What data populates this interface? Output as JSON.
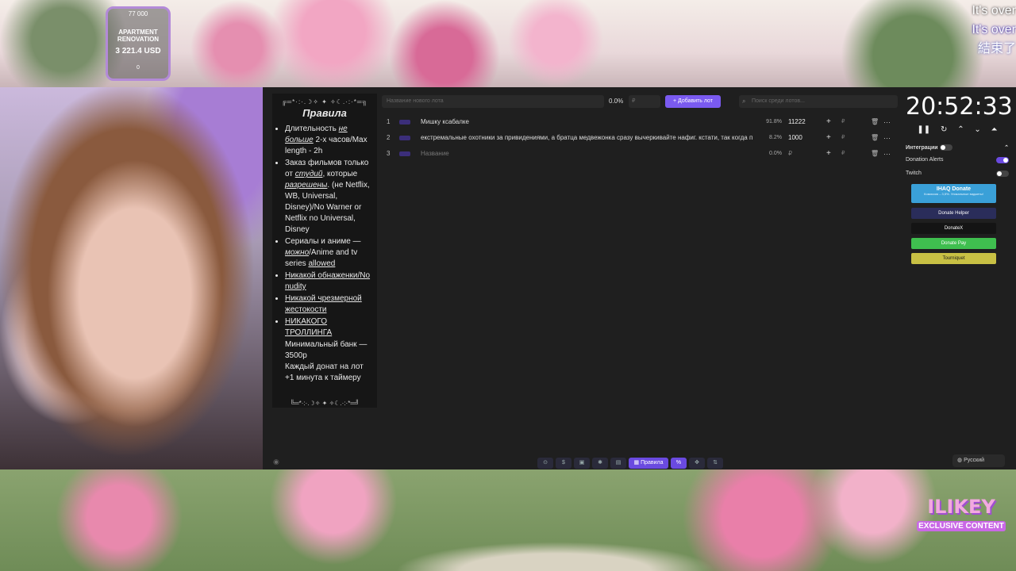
{
  "goal": {
    "top": "77 000",
    "name": "APARTMENT RENOVATION",
    "amount": "3 221.4 USD",
    "bottom": "0"
  },
  "subtitles": [
    "It's over",
    "It's over",
    "結束了"
  ],
  "rules": {
    "deco_top": "╔═*·:·.☽✧ ✦ ✧☾.·:·*═╗",
    "title": "Правила",
    "items": [
      {
        "pre": "Длительность ",
        "em": "не больше",
        "post": " 2-х часов/Max length - 2h"
      },
      {
        "pre": "Заказ фильмов только от ",
        "em": "студий",
        "mid": ", которые ",
        "em2": "разрешены",
        "post": ". (не Netflix, WB, Universal, Disney)/No Warner or Netflix no Universal, Disney"
      },
      {
        "pre": "Сериалы и аниме — ",
        "em": "можно",
        "mid": "/Anime and tv series ",
        "u": "allowed"
      },
      {
        "u": "Никакой обнаженки/No nudity"
      },
      {
        "u": "Никакой чрезмерной жестокости"
      },
      {
        "u": "НИКАКОГО ТРОЛЛИНГА"
      }
    ],
    "line_bank": "Минимальный банк — 3500р",
    "line_timer": "Каждый донат на лот +1 минута к таймеру",
    "deco_bottom": "╚═*·:·.☽✧ ✦ ✧☾.·:·*═╝"
  },
  "toolbar": {
    "new_lot_placeholder": "Название нового лота",
    "percent": "0.0%",
    "currency": "₽",
    "add_button": "Добавить лот",
    "search_placeholder": "Поиск среди лотов..."
  },
  "lots": [
    {
      "num": "1",
      "name": "Мишку ксабалке",
      "pct": "91.8%",
      "amount": "11222",
      "currency": "₽"
    },
    {
      "num": "2",
      "name": "екстремальные охотники за привидениями, а братца медвежонка сразу вычеркивайте нафиг. кстати, так когда п",
      "pct": "8.2%",
      "amount": "1000",
      "currency": "₽"
    },
    {
      "num": "3",
      "name": "Название",
      "pct": "0.0%",
      "amount": "",
      "currency": "₽"
    }
  ],
  "timer": {
    "value": "20:52:33"
  },
  "integrations": {
    "title": "Интеграции",
    "donation_alerts": "Donation Alerts",
    "twitch": "Twitch",
    "ihaq": "IHAQ Donate",
    "ihaq_sub": "Комиссия – 3,5%. Уникальные виджеты!",
    "donate_helper": "Donate Helper",
    "donatex": "DonateX",
    "donate_pay": "Donate Pay",
    "tourniquet": "Tourniquet"
  },
  "bottombar": {
    "rules_tab": "Правила"
  },
  "language": "Русский",
  "badge": {
    "line1": "ILIKEY",
    "line2": "EXCLUSIVE CONTENT"
  }
}
